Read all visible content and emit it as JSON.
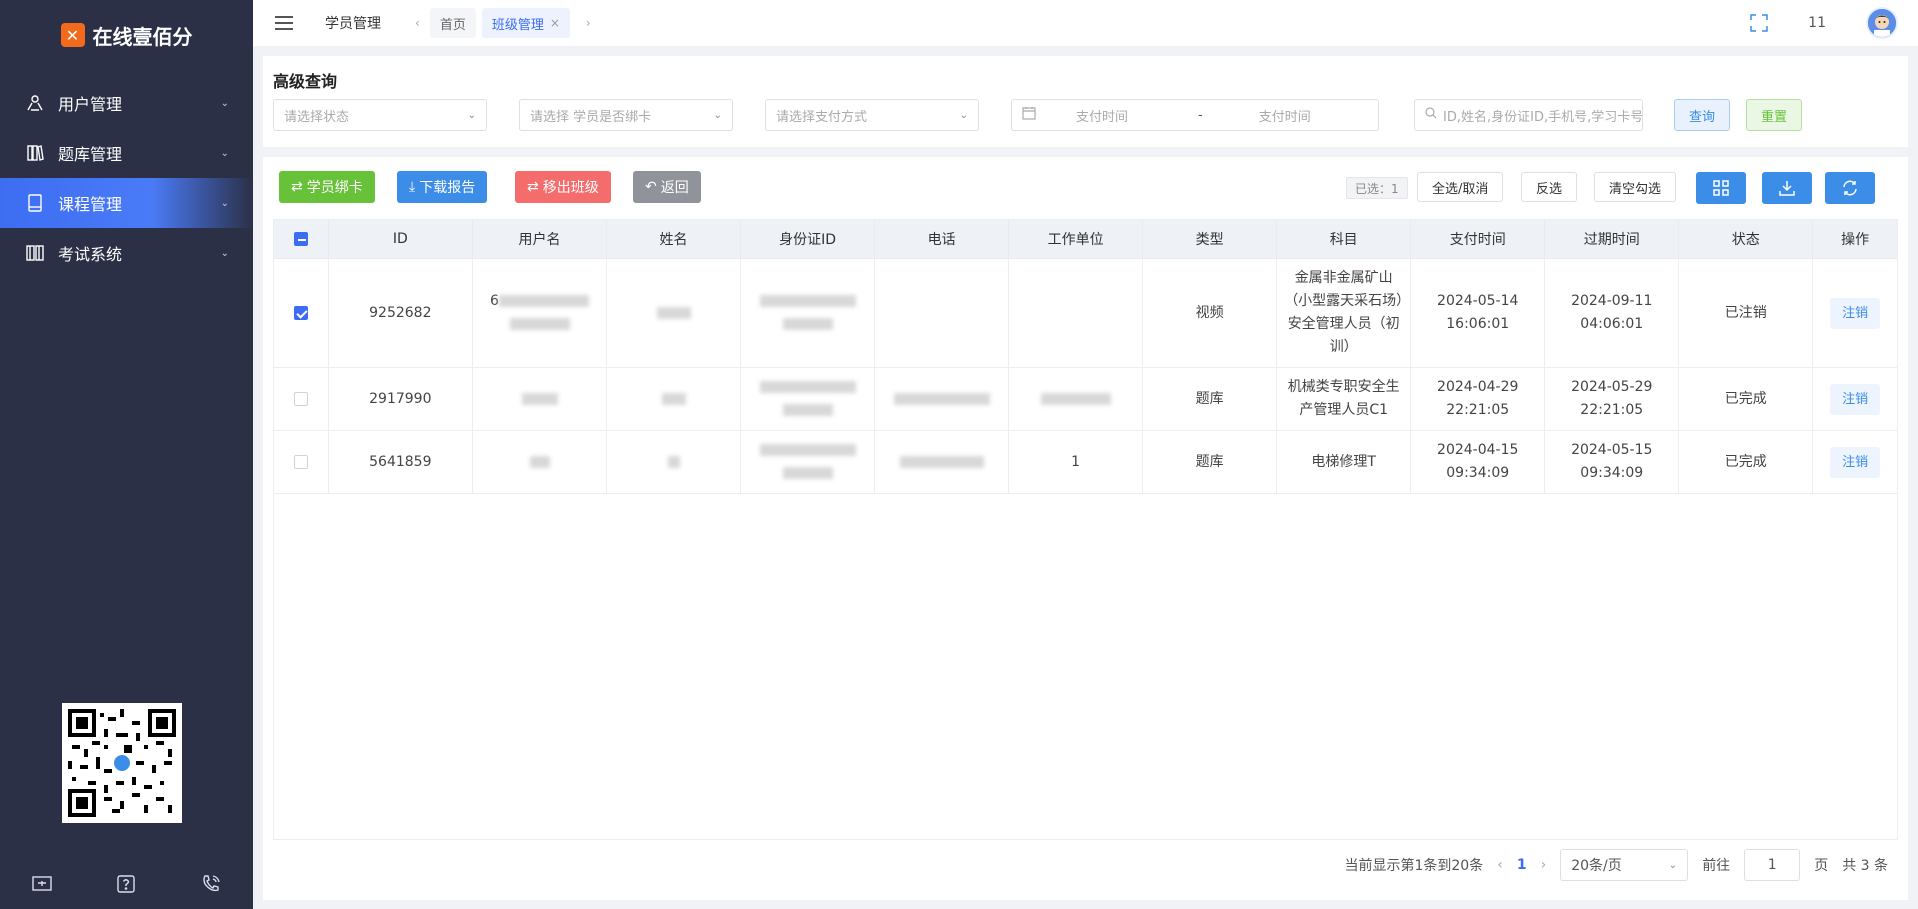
{
  "sidebar": {
    "logo_text": "在线壹佰分",
    "items": [
      {
        "label": "用户管理",
        "icon": "users-icon"
      },
      {
        "label": "题库管理",
        "icon": "book-icon"
      },
      {
        "label": "课程管理",
        "icon": "notebook-icon"
      },
      {
        "label": "考试系统",
        "icon": "exam-icon"
      }
    ]
  },
  "topbar": {
    "page_title": "学员管理",
    "tabs": [
      {
        "label": "首页"
      },
      {
        "label": "班级管理",
        "closable": true
      }
    ],
    "user_number": "11"
  },
  "search": {
    "title": "高级查询",
    "status_placeholder": "请选择状态",
    "bind_placeholder": "请选择 学员是否绑卡",
    "payment_placeholder": "请选择支付方式",
    "pay_time_start": "支付时间",
    "pay_time_sep": "-",
    "pay_time_end": "支付时间",
    "keyword_placeholder": "ID,姓名,身份证ID,手机号,学习卡号",
    "query_label": "查询",
    "reset_label": "重置"
  },
  "toolbar": {
    "bind_card": "学员绑卡",
    "download_report": "下载报告",
    "remove_class": "移出班级",
    "back": "返回",
    "selected": "已选：1",
    "select_all": "全选/取消",
    "invert": "反选",
    "clear": "清空勾选"
  },
  "table": {
    "columns": [
      "ID",
      "用户名",
      "姓名",
      "身份证ID",
      "电话",
      "工作单位",
      "类型",
      "科目",
      "支付时间",
      "过期时间",
      "状态",
      "操作"
    ],
    "rows": [
      {
        "checked": true,
        "id": "9252682",
        "username": "6",
        "type": "视频",
        "subject": "金属非金属矿山（小型露天采石场）安全管理人员（初训）",
        "pay_time": "2024-05-14 16:06:01",
        "expire_time": "2024-09-11 04:06:01",
        "status": "已注销",
        "action": "注销"
      },
      {
        "checked": false,
        "id": "2917990",
        "username": "",
        "type": "题库",
        "subject": "机械类专职安全生产管理人员C1",
        "pay_time": "2024-04-29 22:21:05",
        "expire_time": "2024-05-29 22:21:05",
        "status": "已完成",
        "action": "注销"
      },
      {
        "checked": false,
        "id": "5641859",
        "username": "",
        "work_unit": "1",
        "type": "题库",
        "subject": "电梯修理T",
        "pay_time": "2024-04-15 09:34:09",
        "expire_time": "2024-05-15 09:34:09",
        "status": "已完成",
        "action": "注销"
      }
    ]
  },
  "pager": {
    "summary": "当前显示第1条到20条",
    "current_page": "1",
    "page_size": "20条/页",
    "goto_label": "前往",
    "goto_value": "1",
    "page_unit": "页",
    "total": "共 3 条"
  },
  "colors": {
    "sidebar_bg": "#2b3047",
    "primary": "#3b6cf2",
    "green": "#67c23a",
    "red": "#f56c6c",
    "gray": "#909399"
  }
}
